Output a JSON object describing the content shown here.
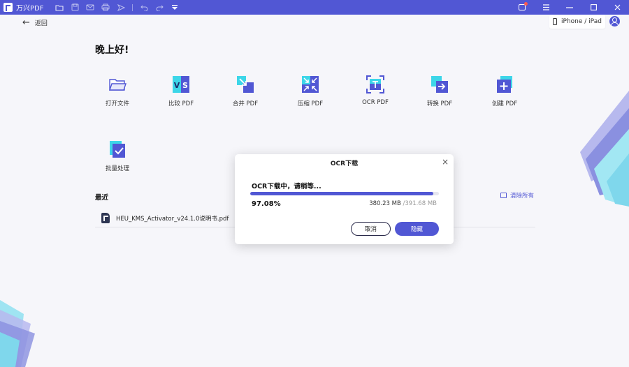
{
  "titlebar": {
    "app_name": "万兴PDF",
    "quick_icons": [
      "folder-icon",
      "save-icon",
      "mail-icon",
      "print-icon",
      "send-icon",
      "undo-icon",
      "redo-icon",
      "dropdown-icon"
    ],
    "window_controls": [
      "notification-icon",
      "menu-icon",
      "minimize-icon",
      "maximize-icon",
      "close-icon"
    ]
  },
  "nav": {
    "back_label": "返回",
    "device_label": "iPhone / iPad"
  },
  "greeting": "晚上好!",
  "tools": [
    {
      "label": "打开文件",
      "icon": "open-folder-icon"
    },
    {
      "label": "比较 PDF",
      "icon": "compare-icon"
    },
    {
      "label": "合并 PDF",
      "icon": "merge-icon"
    },
    {
      "label": "压缩 PDF",
      "icon": "compress-icon"
    },
    {
      "label": "OCR PDF",
      "icon": "ocr-icon"
    },
    {
      "label": "转换 PDF",
      "icon": "convert-icon"
    },
    {
      "label": "创建 PDF",
      "icon": "create-icon"
    },
    {
      "label": "批量处理",
      "icon": "batch-icon"
    }
  ],
  "recent": {
    "title": "最近",
    "clear_label": "清除所有",
    "files": [
      {
        "name": "HEU_KMS_Activator_v24.1.0说明书.pdf"
      }
    ]
  },
  "dialog": {
    "title": "OCR下载",
    "status": "OCR下载中，请稍等...",
    "progress": 0.9708,
    "percent_text": "97.08%",
    "downloaded": "380.23 MB",
    "total": "/391.68 MB",
    "cancel_label": "取消",
    "hide_label": "隐藏"
  },
  "colors": {
    "accent": "#5157d4",
    "background": "#f6f6fa",
    "dialog_bg": "#ffffff"
  }
}
